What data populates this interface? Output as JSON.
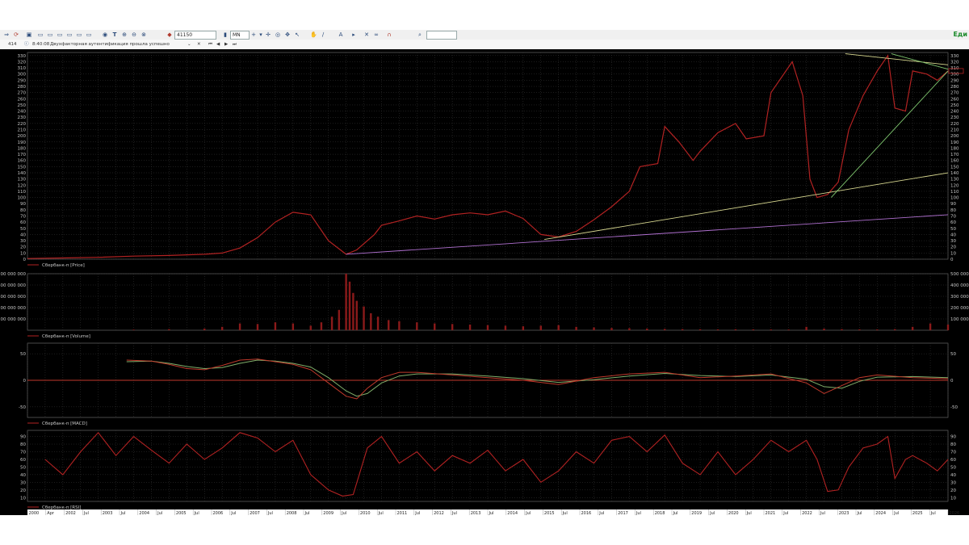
{
  "toolbar": {
    "ticker_code": "41150",
    "timeframe": "MN",
    "brand": "Еди",
    "icons": [
      "arrow-icon",
      "sync-icon",
      "print-icon",
      "window-icon",
      "window-icon",
      "window-icon",
      "window-icon",
      "window-icon",
      "window-icon",
      "window-icon",
      "filter-icon",
      "text-icon",
      "zoom-icon",
      "zoom-icon",
      "zoom-icon"
    ]
  },
  "status": {
    "session": "414",
    "time": "8:40:08",
    "message": "Двухфакторная аутентификация прошла успешно"
  },
  "colors": {
    "background": "#000000",
    "grid": "#3a3a3a",
    "axis_text": "#c8c8c8",
    "price": "#b22222",
    "volume": "#8b1a1a",
    "macd": "#c0392b",
    "signal": "#7fae6a",
    "rsi": "#b22222",
    "trend_yellow": "#d8d890",
    "trend_purple": "#b070d0",
    "trend_green": "#80c870"
  },
  "panes": {
    "price_label": "Сбербанк-п [Price]",
    "volume_label": "Сбербанк-п [Volume]",
    "macd_label": "Сбербанк-п [MACD]",
    "rsi_label": "Сбербанк-п [RSI]"
  },
  "chart_data": [
    {
      "type": "line",
      "name": "Сбербанк-п [Price]",
      "ylim": [
        0,
        335
      ],
      "y_ticks": [
        0,
        10,
        20,
        30,
        40,
        50,
        60,
        70,
        80,
        90,
        100,
        110,
        120,
        130,
        140,
        150,
        160,
        170,
        180,
        190,
        200,
        210,
        220,
        230,
        240,
        250,
        260,
        270,
        280,
        290,
        300,
        310,
        320,
        330
      ],
      "x": [
        2000,
        2001,
        2002,
        2003,
        2004,
        2005,
        2005.5,
        2006,
        2006.5,
        2007,
        2007.5,
        2008,
        2008.5,
        2009,
        2009.3,
        2009.8,
        2010,
        2010.5,
        2011,
        2011.5,
        2012,
        2012.5,
        2013,
        2013.5,
        2014,
        2014.5,
        2015,
        2015.5,
        2016,
        2016.5,
        2017,
        2017.3,
        2017.8,
        2018,
        2018.4,
        2018.8,
        2019,
        2019.5,
        2020,
        2020.3,
        2020.8,
        2021,
        2021.6,
        2021.9,
        2022.1,
        2022.3,
        2022.6,
        2022.9,
        2023.2,
        2023.6,
        2024,
        2024.3,
        2024.5,
        2024.8,
        2025,
        2025.4,
        2025.7,
        2026
      ],
      "values": [
        1,
        2,
        3,
        5,
        6,
        8,
        10,
        18,
        35,
        60,
        76,
        72,
        30,
        8,
        15,
        40,
        55,
        62,
        70,
        65,
        72,
        75,
        72,
        78,
        66,
        40,
        36,
        45,
        64,
        85,
        110,
        150,
        155,
        215,
        190,
        160,
        175,
        205,
        220,
        195,
        200,
        270,
        320,
        265,
        130,
        100,
        105,
        125,
        210,
        265,
        305,
        330,
        245,
        240,
        305,
        300,
        290,
        305
      ],
      "xlim": [
        2000,
        2026
      ],
      "x_ticks": [
        "2000",
        "Apr",
        "2002",
        "Jul",
        "2003",
        "Jul",
        "2004",
        "Jul",
        "2005",
        "Jul",
        "2006",
        "Jul",
        "2007",
        "Jul",
        "2008",
        "Jul",
        "2009",
        "Jul",
        "2010",
        "Jul",
        "2011",
        "Jul",
        "2012",
        "Jul",
        "2013",
        "Jul",
        "2014",
        "Jul",
        "2015",
        "Jul",
        "2016",
        "Jul",
        "2017",
        "Jul",
        "2018",
        "Jul",
        "2019",
        "Jul",
        "2020",
        "Jul",
        "2021",
        "Jul",
        "2022",
        "Jul",
        "2023",
        "Jul",
        "2024",
        "Jul",
        "2025",
        "Jul",
        "2026"
      ],
      "trendlines": [
        {
          "x1": 2009.0,
          "y1": 8,
          "x2": 2026,
          "y2": 72,
          "color": "purple"
        },
        {
          "x1": 2014.6,
          "y1": 32,
          "x2": 2026,
          "y2": 140,
          "color": "yellow"
        },
        {
          "x1": 2022.7,
          "y1": 100,
          "x2": 2026,
          "y2": 305,
          "color": "green"
        },
        {
          "x1": 2023.1,
          "y1": 333,
          "x2": 2026,
          "y2": 315,
          "color": "yellow"
        },
        {
          "x1": 2024.4,
          "y1": 333,
          "x2": 2026,
          "y2": 308,
          "color": "green"
        }
      ]
    },
    {
      "type": "bar",
      "name": "Сбербанк-п [Volume]",
      "ylim": [
        0,
        500000000
      ],
      "y_ticks": [
        100000000,
        200000000,
        300000000,
        400000000,
        500000000
      ],
      "y_tick_labels": [
        "100 000 000",
        "200 000 000",
        "300 000 000",
        "400 000 000",
        "500 000 000"
      ],
      "x": [
        2003,
        2004,
        2005,
        2005.5,
        2006,
        2006.5,
        2007,
        2007.5,
        2008,
        2008.3,
        2008.6,
        2008.8,
        2009,
        2009.1,
        2009.2,
        2009.3,
        2009.5,
        2009.7,
        2009.9,
        2010.2,
        2010.5,
        2011,
        2011.5,
        2012,
        2012.5,
        2013,
        2013.5,
        2014,
        2014.5,
        2015,
        2015.5,
        2016,
        2016.5,
        2017,
        2017.5,
        2018,
        2018.5,
        2019,
        2019.5,
        2020,
        2020.5,
        2021,
        2021.5,
        2022,
        2022.5,
        2023,
        2023.5,
        2024,
        2024.5,
        2025,
        2025.5,
        2026
      ],
      "values": [
        5000000,
        10000000,
        15000000,
        30000000,
        60000000,
        55000000,
        70000000,
        60000000,
        40000000,
        70000000,
        120000000,
        180000000,
        500000000,
        430000000,
        330000000,
        260000000,
        210000000,
        150000000,
        120000000,
        90000000,
        80000000,
        70000000,
        60000000,
        55000000,
        50000000,
        45000000,
        40000000,
        35000000,
        40000000,
        45000000,
        30000000,
        25000000,
        20000000,
        18000000,
        15000000,
        12000000,
        10000000,
        9000000,
        8000000,
        9000000,
        8000000,
        7000000,
        6000000,
        30000000,
        15000000,
        10000000,
        8000000,
        7000000,
        10000000,
        30000000,
        60000000,
        50000000
      ]
    },
    {
      "type": "line",
      "name": "Сбербанк-п [MACD]",
      "ylim": [
        -70,
        70
      ],
      "y_ticks": [
        -50,
        0,
        50
      ],
      "x": [
        2002.8,
        2003.5,
        2004,
        2004.5,
        2005,
        2005.5,
        2006,
        2006.5,
        2007,
        2007.5,
        2008,
        2008.5,
        2009,
        2009.3,
        2009.6,
        2010,
        2010.5,
        2011,
        2012,
        2013,
        2014,
        2015,
        2016,
        2017,
        2018,
        2019,
        2020,
        2021,
        2022,
        2022.5,
        2023,
        2023.5,
        2024,
        2025,
        2026
      ],
      "series": [
        {
          "values": [
            38,
            36,
            30,
            22,
            20,
            28,
            38,
            40,
            35,
            30,
            20,
            -5,
            -30,
            -35,
            -15,
            5,
            15,
            15,
            10,
            5,
            0,
            -8,
            5,
            12,
            15,
            5,
            8,
            12,
            -5,
            -25,
            -10,
            5,
            10,
            5,
            3
          ]
        },
        {
          "values": [
            35,
            36,
            32,
            26,
            22,
            24,
            32,
            38,
            36,
            32,
            25,
            5,
            -20,
            -30,
            -25,
            -5,
            8,
            12,
            12,
            8,
            3,
            -4,
            1,
            8,
            13,
            9,
            7,
            10,
            2,
            -12,
            -15,
            -2,
            6,
            7,
            5
          ]
        }
      ]
    },
    {
      "type": "line",
      "name": "Сбербанк-п [RSI]",
      "ylim": [
        5,
        98
      ],
      "y_ticks": [
        10,
        20,
        30,
        40,
        50,
        60,
        70,
        80,
        90
      ],
      "x": [
        2000.5,
        2001,
        2001.5,
        2002,
        2002.5,
        2003,
        2003.5,
        2004,
        2004.5,
        2005,
        2005.5,
        2006,
        2006.5,
        2007,
        2007.5,
        2008,
        2008.5,
        2008.9,
        2009.2,
        2009.6,
        2010,
        2010.5,
        2011,
        2011.5,
        2012,
        2012.5,
        2013,
        2013.5,
        2014,
        2014.5,
        2015,
        2015.5,
        2016,
        2016.5,
        2017,
        2017.5,
        2018,
        2018.5,
        2019,
        2019.5,
        2020,
        2020.5,
        2021,
        2021.5,
        2022,
        2022.3,
        2022.6,
        2022.9,
        2023.2,
        2023.6,
        2024,
        2024.3,
        2024.5,
        2024.8,
        2025,
        2025.4,
        2025.7,
        2026
      ],
      "values": [
        60,
        40,
        70,
        95,
        65,
        90,
        72,
        55,
        80,
        60,
        75,
        95,
        88,
        70,
        85,
        40,
        20,
        12,
        14,
        75,
        90,
        55,
        70,
        45,
        65,
        55,
        72,
        45,
        60,
        30,
        45,
        70,
        55,
        85,
        90,
        70,
        92,
        55,
        40,
        70,
        40,
        60,
        85,
        70,
        85,
        60,
        18,
        20,
        50,
        75,
        80,
        90,
        35,
        60,
        65,
        55,
        45,
        60
      ]
    }
  ]
}
